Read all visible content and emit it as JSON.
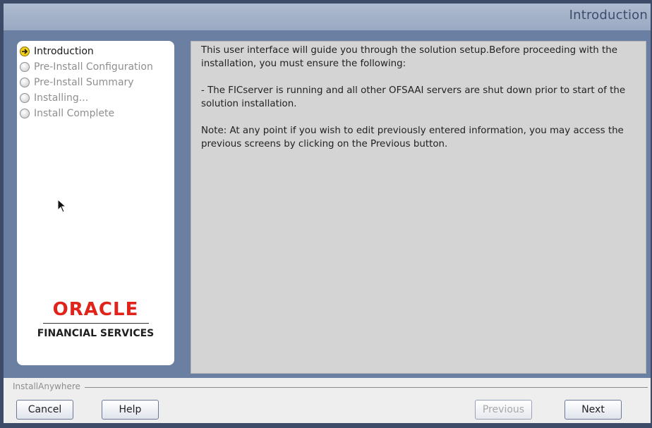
{
  "header": {
    "title": "Introduction"
  },
  "steps": [
    {
      "label": "Introduction",
      "state": "current",
      "icon": "arrow-right-icon"
    },
    {
      "label": "Pre-Install Configuration",
      "state": "pending",
      "icon": "radio-icon"
    },
    {
      "label": "Pre-Install Summary",
      "state": "pending",
      "icon": "radio-icon"
    },
    {
      "label": "Installing...",
      "state": "pending",
      "icon": "radio-icon"
    },
    {
      "label": "Install Complete",
      "state": "pending",
      "icon": "radio-icon"
    }
  ],
  "logo": {
    "brand": "ORACLE",
    "tagline": "FINANCIAL SERVICES",
    "brand_color": "#e0231b"
  },
  "content": {
    "paragraphs": [
      "This user interface will guide you through the solution setup.Before proceeding with the installation, you must ensure the following:",
      "- The FICserver is running and all other OFSAAI servers are shut down prior to start of the solution installation.",
      "Note: At any point if you wish to edit previously entered information, you may access the previous screens by clicking on the Previous button."
    ]
  },
  "footer": {
    "brand": "InstallAnywhere",
    "buttons": {
      "cancel": "Cancel",
      "help": "Help",
      "previous": "Previous",
      "next": "Next"
    }
  },
  "colors": {
    "background": "#3d4b68",
    "panel": "#6b7fa3",
    "header": "#aebbd0"
  }
}
